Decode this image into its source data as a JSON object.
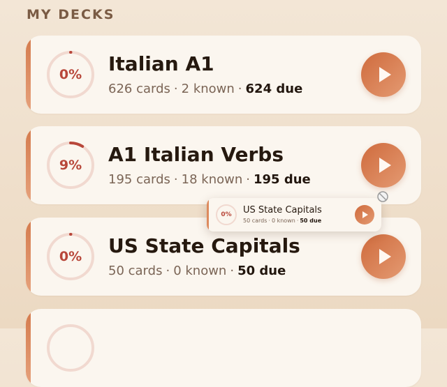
{
  "section": {
    "title": "MY DECKS"
  },
  "colors": {
    "accent": "#d47a4c",
    "progress": "#b8473a",
    "play": "#cf6b3d"
  },
  "decks": [
    {
      "name": "Italian A1",
      "percent": "0%",
      "progress": 0.0,
      "cards": "626 cards",
      "known": "2 known",
      "due": "624 due"
    },
    {
      "name": "A1 Italian Verbs",
      "percent": "9%",
      "progress": 0.09,
      "cards": "195 cards",
      "known": "18 known",
      "due": "195 due"
    },
    {
      "name": "US State Capitals",
      "percent": "0%",
      "progress": 0.0,
      "cards": "50 cards",
      "known": "0 known",
      "due": "50 due"
    }
  ],
  "drag_preview": {
    "name": "US State Capitals",
    "percent": "0%",
    "progress": 0.0,
    "cards": "50 cards",
    "known": "0 known",
    "due": "50 due"
  },
  "separator": "·",
  "icons": {
    "play": "play-icon",
    "no_drop": "no-drop-icon"
  }
}
